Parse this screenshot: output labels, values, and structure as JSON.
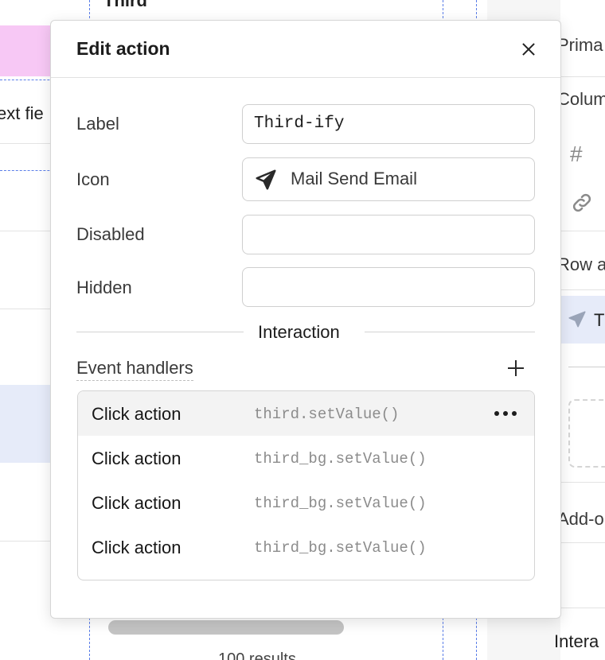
{
  "background": {
    "grid_header_text": "Third",
    "left_cell_text": "ext fie",
    "footer_text": "100 results",
    "right_panel": {
      "primary_label": "Prima",
      "column_label": "Colum",
      "row_action_label": "Row a",
      "row_item_label": "T",
      "addons_label": "Add-o",
      "interaction_label": "Intera",
      "hash_icon": "hash-icon",
      "link_icon": "link-icon",
      "send_icon": "send-icon"
    }
  },
  "modal": {
    "title": "Edit action",
    "close_icon": "close-icon",
    "fields": {
      "label": {
        "label": "Label",
        "value": "Third-ify"
      },
      "icon": {
        "label": "Icon",
        "value": "Mail Send Email",
        "icon": "paper-plane-icon"
      },
      "disabled": {
        "label": "Disabled",
        "value": ""
      },
      "hidden": {
        "label": "Hidden",
        "value": ""
      }
    },
    "section_title": "Interaction",
    "event_handlers": {
      "label": "Event handlers",
      "add_icon": "plus-icon",
      "items": [
        {
          "name": "Click action",
          "code": "third.setValue()",
          "active": true
        },
        {
          "name": "Click action",
          "code": "third_bg.setValue()",
          "active": false
        },
        {
          "name": "Click action",
          "code": "third_bg.setValue()",
          "active": false
        },
        {
          "name": "Click action",
          "code": "third_bg.setValue()",
          "active": false
        }
      ],
      "more_icon": "more-horizontal-icon"
    }
  }
}
